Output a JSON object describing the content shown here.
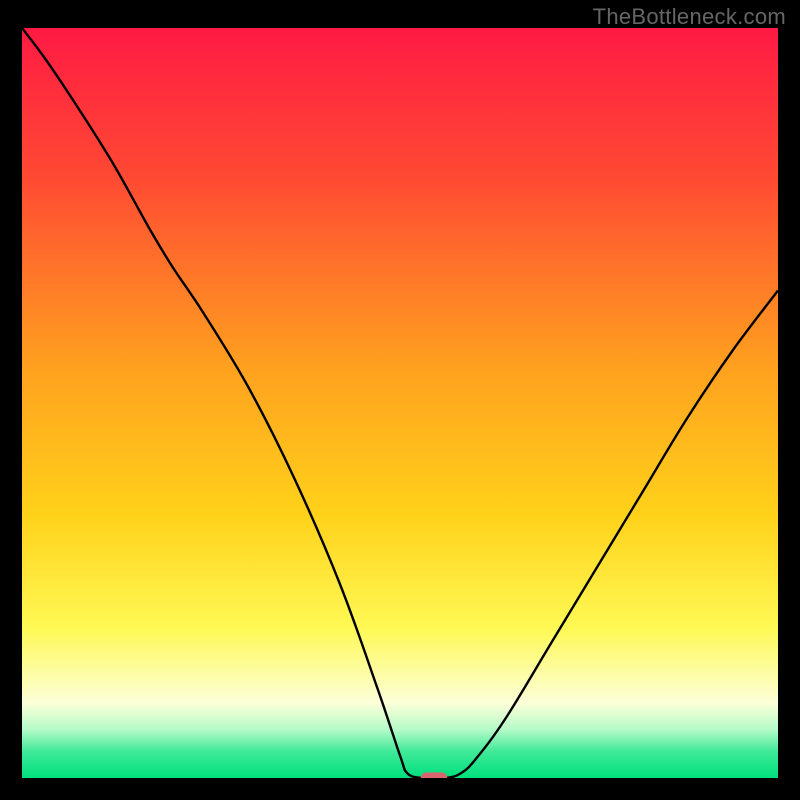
{
  "watermark": "TheBottleneck.com",
  "chart_data": {
    "type": "line",
    "title": "",
    "xlabel": "",
    "ylabel": "",
    "xlim": [
      0,
      100
    ],
    "ylim": [
      0,
      100
    ],
    "background_gradient": {
      "stops": [
        {
          "pos": 0.0,
          "color": "#ff1a44"
        },
        {
          "pos": 0.2,
          "color": "#ff4a33"
        },
        {
          "pos": 0.45,
          "color": "#ffa01f"
        },
        {
          "pos": 0.65,
          "color": "#ffd21a"
        },
        {
          "pos": 0.8,
          "color": "#fff955"
        },
        {
          "pos": 0.9,
          "color": "#fcffd9"
        },
        {
          "pos": 0.935,
          "color": "#b6fbc8"
        },
        {
          "pos": 0.965,
          "color": "#3fe998"
        },
        {
          "pos": 1.0,
          "color": "#00e07e"
        }
      ]
    },
    "series": [
      {
        "name": "bottleneck-curve",
        "color": "#000000",
        "points": [
          {
            "x": 0,
            "y": 100
          },
          {
            "x": 3,
            "y": 96
          },
          {
            "x": 7,
            "y": 90
          },
          {
            "x": 12,
            "y": 82
          },
          {
            "x": 17,
            "y": 73
          },
          {
            "x": 20,
            "y": 68
          },
          {
            "x": 24,
            "y": 62
          },
          {
            "x": 30,
            "y": 52
          },
          {
            "x": 36,
            "y": 40
          },
          {
            "x": 42,
            "y": 26
          },
          {
            "x": 47,
            "y": 12
          },
          {
            "x": 50,
            "y": 3
          },
          {
            "x": 51,
            "y": 0.6
          },
          {
            "x": 53,
            "y": 0
          },
          {
            "x": 56,
            "y": 0
          },
          {
            "x": 58,
            "y": 0.6
          },
          {
            "x": 60,
            "y": 2.5
          },
          {
            "x": 64,
            "y": 8
          },
          {
            "x": 70,
            "y": 18
          },
          {
            "x": 76,
            "y": 28
          },
          {
            "x": 82,
            "y": 38
          },
          {
            "x": 88,
            "y": 48
          },
          {
            "x": 94,
            "y": 57
          },
          {
            "x": 100,
            "y": 65
          }
        ]
      }
    ],
    "marker": {
      "x": 54.5,
      "y": 0,
      "color": "#d9666f",
      "width": 3.5,
      "height": 1.5
    }
  }
}
